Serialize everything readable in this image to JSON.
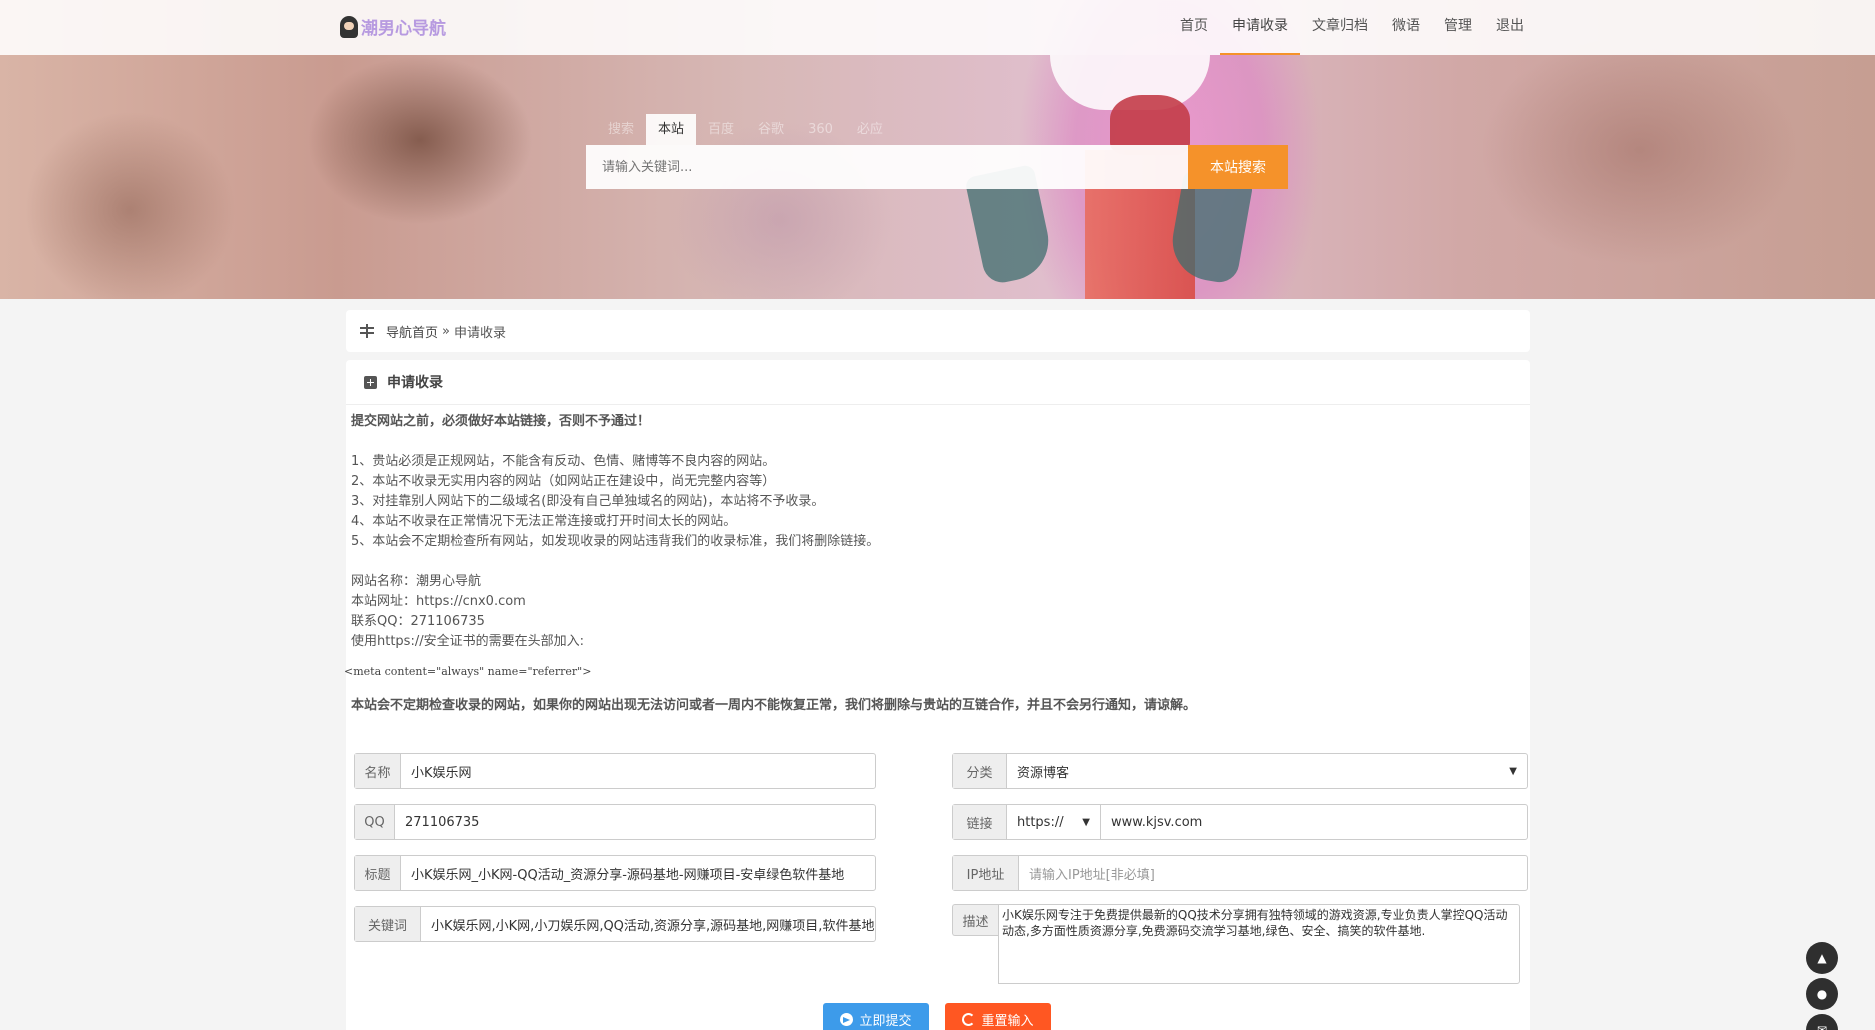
{
  "site": {
    "brand": "潮男心导航"
  },
  "nav": {
    "items": [
      "首页",
      "申请收录",
      "文章归档",
      "微语",
      "管理",
      "退出"
    ],
    "active_index": 1
  },
  "search": {
    "tabs": [
      "搜索",
      "本站",
      "百度",
      "谷歌",
      "360",
      "必应"
    ],
    "active_tab": "本站",
    "placeholder": "请输入关键词...",
    "button": "本站搜索"
  },
  "breadcrumb": {
    "home": "导航首页",
    "separator": "»",
    "current": "申请收录"
  },
  "card": {
    "title": "申请收录",
    "warning_top": "提交网站之前，必须做好本站链接，否则不予通过！",
    "rules": [
      "1、贵站必须是正规网站，不能含有反动、色情、赌博等不良内容的网站。",
      "2、本站不收录无实用内容的网站（如网站正在建设中，尚无完整内容等）",
      "3、对挂靠别人网站下的二级域名(即没有自己单独域名的网站)，本站将不予收录。",
      "4、本站不收录在正常情况下无法正常连接或打开时间太长的网站。",
      "5、本站会不定期检查所有网站，如发现收录的网站违背我们的收录标准，我们将删除链接。"
    ],
    "site_info": [
      "网站名称：潮男心导航",
      "本站网址：https://cnx0.com",
      "联系QQ：271106735",
      "使用https://安全证书的需要在头部加入:"
    ],
    "meta_code": "<meta content=\"always\" name=\"referrer\">",
    "warning_bottom": "本站会不定期检查收录的网站，如果你的网站出现无法访问或者一周内不能恢复正常，我们将删除与贵站的互链合作，并且不会另行通知，请谅解。"
  },
  "form": {
    "name": {
      "label": "名称",
      "value": "小K娱乐网"
    },
    "category": {
      "label": "分类",
      "value": "资源博客"
    },
    "qq": {
      "label": "QQ",
      "value": "271106735"
    },
    "link": {
      "label": "链接",
      "protocol": "https://",
      "value": "www.kjsv.com"
    },
    "title": {
      "label": "标题",
      "value": "小K娱乐网_小K网-QQ活动_资源分享-源码基地-网赚项目-安卓绿色软件基地"
    },
    "ip": {
      "label": "IP地址",
      "placeholder": "请输入IP地址[非必填]"
    },
    "keywords": {
      "label": "关键词",
      "value": "小K娱乐网,小K网,小刀娱乐网,QQ活动,资源分享,源码基地,网赚项目,软件基地"
    },
    "description": {
      "label": "描述",
      "value": "小K娱乐网专注于免费提供最新的QQ技术分享拥有独特领域的游戏资源,专业负责人掌控QQ活动动态,多方面性质资源分享,免费源码交流学习基地,绿色、安全、搞笑的软件基地."
    },
    "submit": "立即提交",
    "reset": "重置输入"
  },
  "float_buttons": [
    "arrow-up-icon",
    "bell-icon",
    "mail-icon"
  ],
  "colors": {
    "accent": "#f5922a",
    "brand": "#b79ae0",
    "warning": "#e3332c",
    "submit": "#3d9bea",
    "reset": "#ff5722"
  }
}
